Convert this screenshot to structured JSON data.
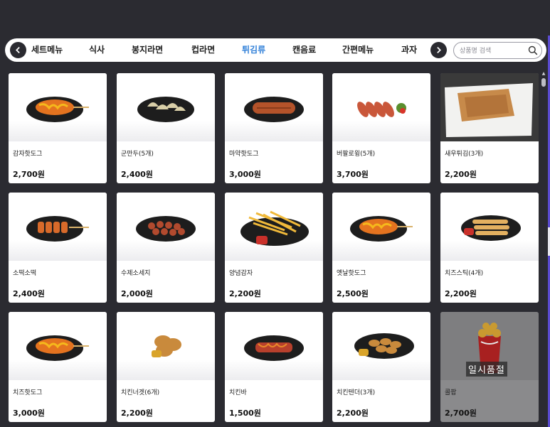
{
  "categories": {
    "prev_icon": "chevron-left-icon",
    "next_icon": "chevron-right-icon",
    "tabs": [
      {
        "label": "세트메뉴"
      },
      {
        "label": "식사"
      },
      {
        "label": "봉지라면"
      },
      {
        "label": "컵라면"
      },
      {
        "label": "튀김류"
      },
      {
        "label": "캔음료"
      },
      {
        "label": "간편메뉴"
      },
      {
        "label": "과자"
      }
    ],
    "active_tab": "튀김류",
    "active_color": "#2f7fd8"
  },
  "search": {
    "placeholder": "상품명 검색",
    "value": "",
    "icon": "search-icon"
  },
  "products": [
    {
      "name": "감자핫도그",
      "price": "2,700원",
      "image": "corndog-icon"
    },
    {
      "name": "군만두(5개)",
      "price": "2,400원",
      "image": "dumplings-icon"
    },
    {
      "name": "마약핫도그",
      "price": "3,000원",
      "image": "sausage-icon"
    },
    {
      "name": "버팔로윙(5개)",
      "price": "3,700원",
      "image": "wings-icon"
    },
    {
      "name": "새우튀김(3개)",
      "price": "2,200원",
      "image": "fried-shrimp-icon"
    },
    {
      "name": "소떡소떡",
      "price": "2,400원",
      "image": "sotteok-icon"
    },
    {
      "name": "수제소세지",
      "price": "2,000원",
      "image": "sausage-slices-icon"
    },
    {
      "name": "양념감자",
      "price": "2,200원",
      "image": "fries-icon"
    },
    {
      "name": "옛날핫도그",
      "price": "2,500원",
      "image": "corndog-icon"
    },
    {
      "name": "치즈스틱(4개)",
      "price": "2,200원",
      "image": "cheese-stick-icon"
    },
    {
      "name": "치즈핫도그",
      "price": "3,000원",
      "image": "corndog-icon"
    },
    {
      "name": "치킨너겟(6개)",
      "price": "2,200원",
      "image": "nuggets-icon"
    },
    {
      "name": "치킨바",
      "price": "1,500원",
      "image": "chicken-bar-icon"
    },
    {
      "name": "치킨텐더(3개)",
      "price": "2,200원",
      "image": "tenders-icon"
    },
    {
      "name": "콜팝",
      "price": "2,700원",
      "image": "colpop-icon",
      "status": "일시품절"
    }
  ]
}
